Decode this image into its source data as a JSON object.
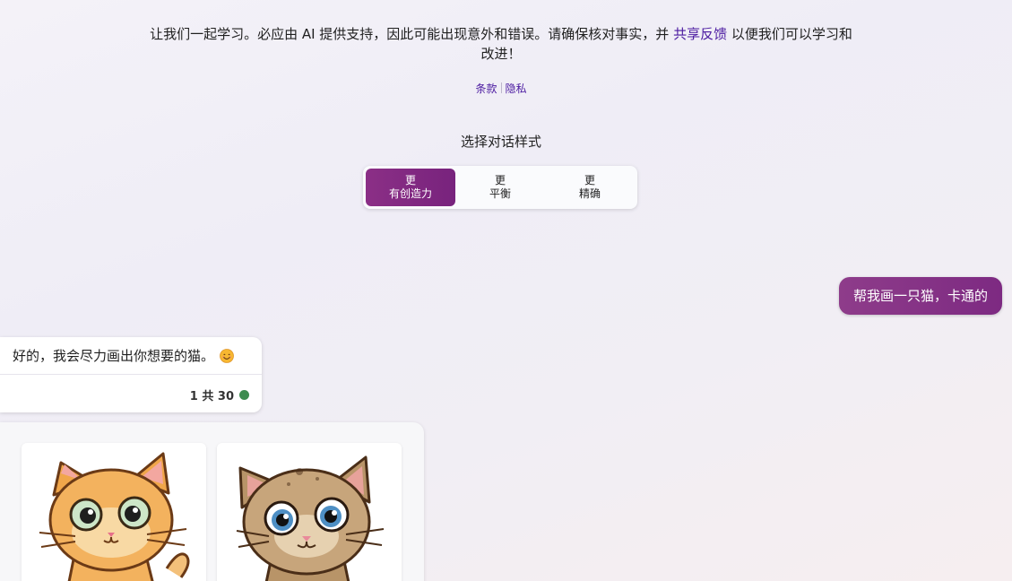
{
  "disclaimer": {
    "text_before_link": "让我们一起学习。必应由 AI 提供支持，因此可能出现意外和错误。请确保核对事实，并",
    "feedback_link": "共享反馈",
    "text_after_link": "以便我们可以学习和改进！"
  },
  "legal": {
    "terms_label": "条款",
    "privacy_label": "隐私"
  },
  "conversation_style": {
    "title": "选择对话样式",
    "options": [
      {
        "line1": "更",
        "line2": "有创造力",
        "selected": true
      },
      {
        "line1": "更",
        "line2": "平衡",
        "selected": false
      },
      {
        "line1": "更",
        "line2": "精确",
        "selected": false
      }
    ]
  },
  "messages": {
    "user_message": "帮我画一只猫，卡通的",
    "bot_reply": "好的，我会尽力画出你想要的猫。",
    "bot_emoji_icon": "smiling-face-icon",
    "turn_counter": "1 共 30",
    "status_color": "#3d8b4f"
  },
  "images": [
    {
      "subject": "orange-cartoon-cat"
    },
    {
      "subject": "brown-cartoon-cat"
    }
  ],
  "colors": {
    "accent": "#862d84",
    "link": "#4b1aa0"
  }
}
